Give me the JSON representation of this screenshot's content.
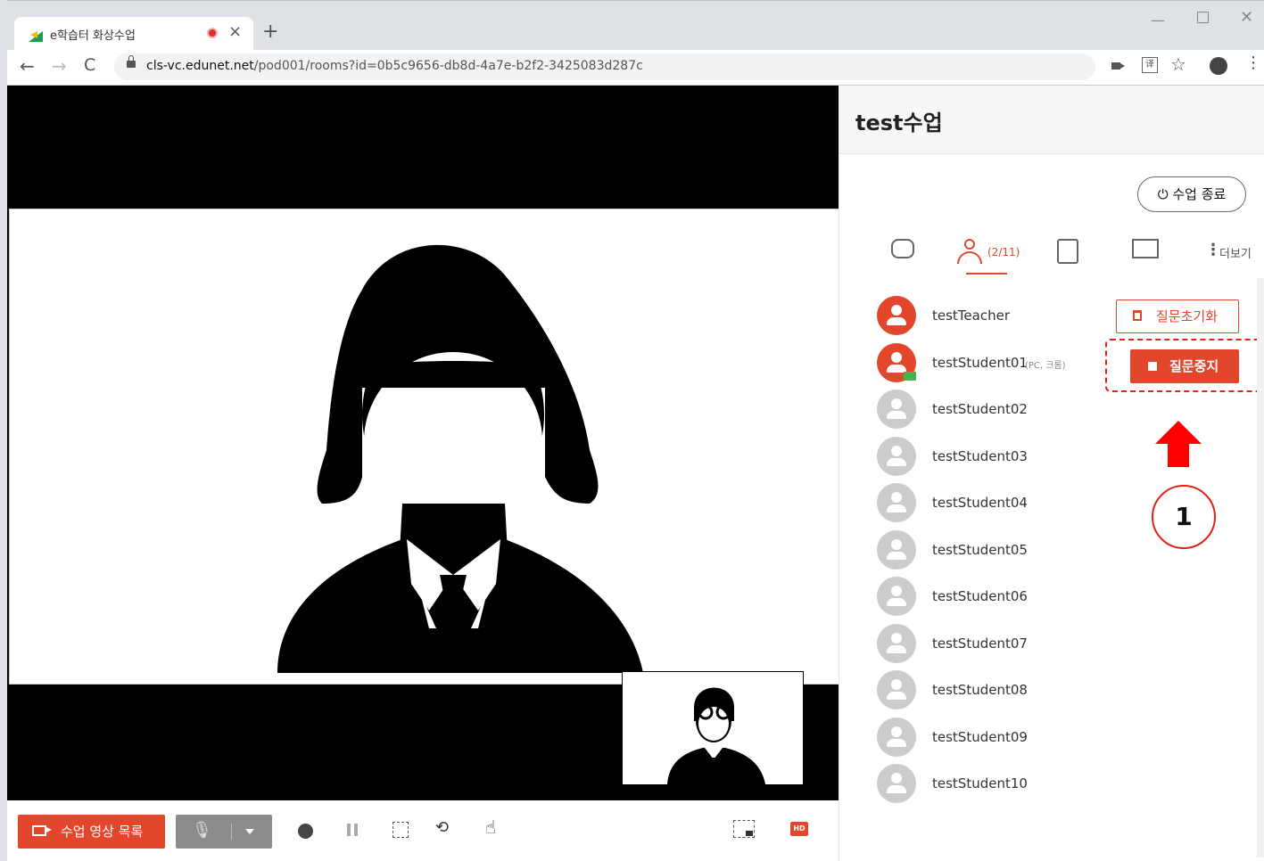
{
  "browser": {
    "tab_title": "e학습터 화상수업",
    "tab_close": "×",
    "new_tab": "+",
    "url_host": "cls-vc.edunet.net",
    "url_path": "/pod001/rooms?id=0b5c9656-db8d-4a7e-b2f2-3425083d287c",
    "translate_glyph": "译",
    "star_glyph": "☆",
    "menu_glyph": "⋮",
    "back_glyph": "←",
    "forward_glyph": "→",
    "reload_glyph": "C",
    "min_glyph": "—",
    "close_glyph": "✕"
  },
  "room": {
    "title": "test수업",
    "end_class_label": "⏻ 수업 종료"
  },
  "tabs": {
    "users_count": "(2/11)",
    "more_label": "더보기",
    "more_glyph": "⋮"
  },
  "users": [
    {
      "name": "testTeacher",
      "active": true,
      "device": ""
    },
    {
      "name": "testStudent01",
      "active": true,
      "device": "(PC, 크롬)"
    },
    {
      "name": "testStudent02",
      "active": false,
      "device": ""
    },
    {
      "name": "testStudent03",
      "active": false,
      "device": ""
    },
    {
      "name": "testStudent04",
      "active": false,
      "device": ""
    },
    {
      "name": "testStudent05",
      "active": false,
      "device": ""
    },
    {
      "name": "testStudent06",
      "active": false,
      "device": ""
    },
    {
      "name": "testStudent07",
      "active": false,
      "device": ""
    },
    {
      "name": "testStudent08",
      "active": false,
      "device": ""
    },
    {
      "name": "testStudent09",
      "active": false,
      "device": ""
    },
    {
      "name": "testStudent10",
      "active": false,
      "device": ""
    }
  ],
  "questions": {
    "reset_label": "질문초기화",
    "stop_label": "질문중지"
  },
  "annotation": {
    "step_number": "1"
  },
  "bottom_bar": {
    "video_list_label": "수업 영상 목록",
    "hd_label": "HD",
    "mic_glyph": "🎙",
    "rotate_glyph": "⟲",
    "hand_glyph": "☝"
  },
  "side_collapse_glyph": "›",
  "colors": {
    "accent": "#e2472c",
    "annotation_red": "#ff0000"
  }
}
